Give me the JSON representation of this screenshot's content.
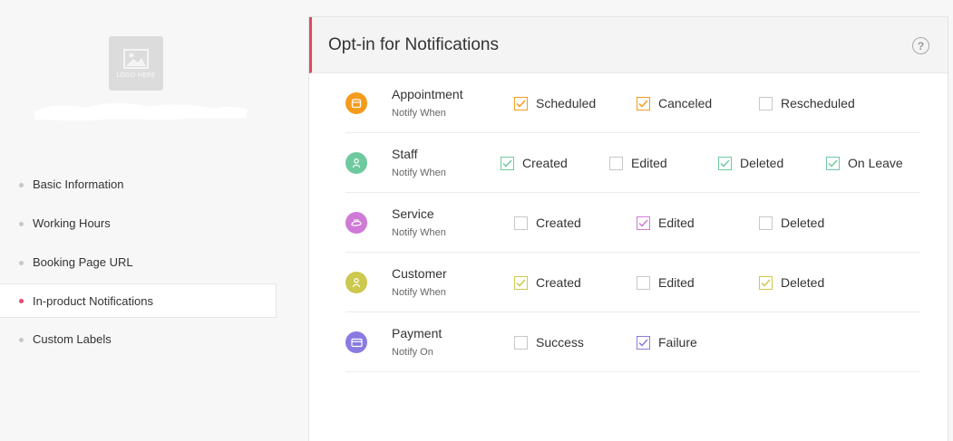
{
  "sidebar": {
    "logo_text": "LOGO HERE",
    "items": [
      {
        "label": "Basic Information",
        "active": false
      },
      {
        "label": "Working Hours",
        "active": false
      },
      {
        "label": "Booking Page URL",
        "active": false
      },
      {
        "label": "In-product Notifications",
        "active": true
      },
      {
        "label": "Custom Labels",
        "active": false
      }
    ]
  },
  "panel": {
    "title": "Opt-in for Notifications",
    "help": "?"
  },
  "colors": {
    "accent": "#e04a5f",
    "active_dot": "#e8486c"
  },
  "rows": [
    {
      "title": "Appointment",
      "sub": "Notify When",
      "icon": "appointment-icon",
      "color": "#f59b1c",
      "options": [
        {
          "label": "Scheduled",
          "checked": true
        },
        {
          "label": "Canceled",
          "checked": true
        },
        {
          "label": "Rescheduled",
          "checked": false
        }
      ]
    },
    {
      "title": "Staff",
      "sub": "Notify When",
      "icon": "staff-icon",
      "color": "#6fc99f",
      "options": [
        {
          "label": "Created",
          "checked": true
        },
        {
          "label": "Edited",
          "checked": false
        },
        {
          "label": "Deleted",
          "checked": true
        },
        {
          "label": "On Leave",
          "checked": true
        }
      ]
    },
    {
      "title": "Service",
      "sub": "Notify When",
      "icon": "service-icon",
      "color": "#cf7ad6",
      "options": [
        {
          "label": "Created",
          "checked": false
        },
        {
          "label": "Edited",
          "checked": true
        },
        {
          "label": "Deleted",
          "checked": false
        }
      ]
    },
    {
      "title": "Customer",
      "sub": "Notify When",
      "icon": "customer-icon",
      "color": "#cdc84e",
      "options": [
        {
          "label": "Created",
          "checked": true
        },
        {
          "label": "Edited",
          "checked": false
        },
        {
          "label": "Deleted",
          "checked": true
        }
      ]
    },
    {
      "title": "Payment",
      "sub": "Notify On",
      "icon": "payment-icon",
      "color": "#8a7be0",
      "options": [
        {
          "label": "Success",
          "checked": false
        },
        {
          "label": "Failure",
          "checked": true
        }
      ]
    }
  ]
}
